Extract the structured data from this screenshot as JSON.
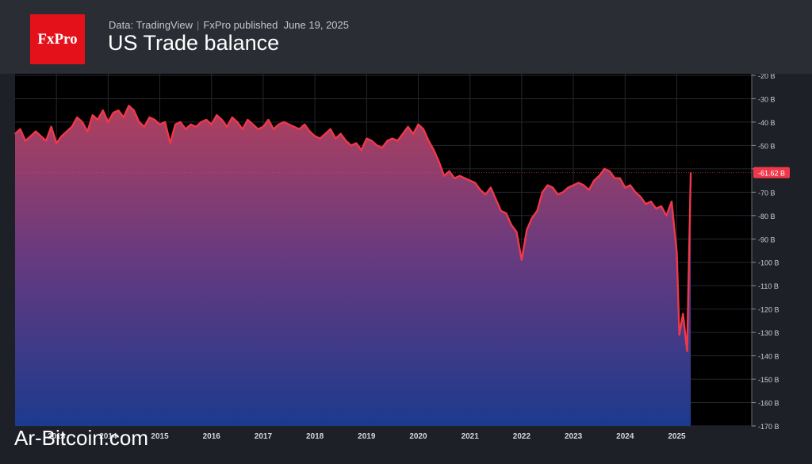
{
  "header": {
    "logo_text": "FxPro",
    "source": "Data: TradingView",
    "publisher": "FxPro published",
    "date": "June 19, 2025",
    "title": "US Trade balance"
  },
  "watermark": "Ar-Bitcoin.com",
  "chart_data": {
    "type": "area",
    "title": "US Trade balance",
    "xlabel": "",
    "ylabel": "",
    "grid": true,
    "unit": "B",
    "ylim": [
      -170,
      -20
    ],
    "xlim": [
      2012.2,
      2026.45
    ],
    "y_ticks": [
      "-20 B",
      "-30 B",
      "-40 B",
      "-50 B",
      "-60 B",
      "-70 B",
      "-80 B",
      "-90 B",
      "-100 B",
      "-110 B",
      "-120 B",
      "-130 B",
      "-140 B",
      "-150 B",
      "-160 B",
      "-170 B"
    ],
    "x_ticks": [
      {
        "label": "2013",
        "value": 2013.0
      },
      {
        "label": "2014",
        "value": 2014.0
      },
      {
        "label": "2015",
        "value": 2015.0
      },
      {
        "label": "2016",
        "value": 2016.0
      },
      {
        "label": "2017",
        "value": 2017.0
      },
      {
        "label": "2018",
        "value": 2018.0
      },
      {
        "label": "2019",
        "value": 2019.0
      },
      {
        "label": "2020",
        "value": 2020.0
      },
      {
        "label": "2021",
        "value": 2021.0
      },
      {
        "label": "2022",
        "value": 2022.0
      },
      {
        "label": "2023",
        "value": 2023.0
      },
      {
        "label": "2024",
        "value": 2024.0
      },
      {
        "label": "2025",
        "value": 2025.0
      }
    ],
    "last_value": -61.62,
    "last_label": "-61.62 B",
    "series": [
      {
        "points": [
          [
            2012.2,
            -45
          ],
          [
            2012.3,
            -43
          ],
          [
            2012.4,
            -48
          ],
          [
            2012.5,
            -46
          ],
          [
            2012.6,
            -44
          ],
          [
            2012.7,
            -46
          ],
          [
            2012.8,
            -48
          ],
          [
            2012.9,
            -42
          ],
          [
            2013.0,
            -49
          ],
          [
            2013.1,
            -46
          ],
          [
            2013.2,
            -44
          ],
          [
            2013.3,
            -42
          ],
          [
            2013.4,
            -38
          ],
          [
            2013.5,
            -40
          ],
          [
            2013.6,
            -44
          ],
          [
            2013.7,
            -37
          ],
          [
            2013.8,
            -39
          ],
          [
            2013.9,
            -35
          ],
          [
            2014.0,
            -40
          ],
          [
            2014.1,
            -36
          ],
          [
            2014.2,
            -35
          ],
          [
            2014.3,
            -38
          ],
          [
            2014.4,
            -33
          ],
          [
            2014.5,
            -35
          ],
          [
            2014.6,
            -40
          ],
          [
            2014.7,
            -42
          ],
          [
            2014.8,
            -38
          ],
          [
            2014.9,
            -39
          ],
          [
            2015.0,
            -41
          ],
          [
            2015.1,
            -40
          ],
          [
            2015.2,
            -49
          ],
          [
            2015.3,
            -41
          ],
          [
            2015.4,
            -40
          ],
          [
            2015.5,
            -43
          ],
          [
            2015.6,
            -41
          ],
          [
            2015.7,
            -42
          ],
          [
            2015.8,
            -40
          ],
          [
            2015.9,
            -39
          ],
          [
            2016.0,
            -41
          ],
          [
            2016.1,
            -37
          ],
          [
            2016.2,
            -39
          ],
          [
            2016.3,
            -42
          ],
          [
            2016.4,
            -38
          ],
          [
            2016.5,
            -40
          ],
          [
            2016.6,
            -43
          ],
          [
            2016.7,
            -39
          ],
          [
            2016.8,
            -41
          ],
          [
            2016.9,
            -43
          ],
          [
            2017.0,
            -42
          ],
          [
            2017.1,
            -39
          ],
          [
            2017.2,
            -43
          ],
          [
            2017.3,
            -41
          ],
          [
            2017.4,
            -40
          ],
          [
            2017.5,
            -41
          ],
          [
            2017.6,
            -42
          ],
          [
            2017.7,
            -43
          ],
          [
            2017.8,
            -41
          ],
          [
            2017.9,
            -44
          ],
          [
            2018.0,
            -46
          ],
          [
            2018.1,
            -47
          ],
          [
            2018.2,
            -45
          ],
          [
            2018.3,
            -43
          ],
          [
            2018.4,
            -47
          ],
          [
            2018.5,
            -45
          ],
          [
            2018.6,
            -48
          ],
          [
            2018.7,
            -50
          ],
          [
            2018.8,
            -49
          ],
          [
            2018.9,
            -52
          ],
          [
            2019.0,
            -47
          ],
          [
            2019.1,
            -48
          ],
          [
            2019.2,
            -50
          ],
          [
            2019.3,
            -51
          ],
          [
            2019.4,
            -48
          ],
          [
            2019.5,
            -47
          ],
          [
            2019.6,
            -48
          ],
          [
            2019.7,
            -45
          ],
          [
            2019.8,
            -42
          ],
          [
            2019.9,
            -45
          ],
          [
            2020.0,
            -41
          ],
          [
            2020.1,
            -43
          ],
          [
            2020.2,
            -48
          ],
          [
            2020.3,
            -52
          ],
          [
            2020.4,
            -57
          ],
          [
            2020.5,
            -63
          ],
          [
            2020.6,
            -61
          ],
          [
            2020.7,
            -64
          ],
          [
            2020.8,
            -63
          ],
          [
            2020.9,
            -64
          ],
          [
            2021.0,
            -65
          ],
          [
            2021.1,
            -66
          ],
          [
            2021.2,
            -69
          ],
          [
            2021.3,
            -71
          ],
          [
            2021.4,
            -68
          ],
          [
            2021.5,
            -73
          ],
          [
            2021.6,
            -78
          ],
          [
            2021.7,
            -79
          ],
          [
            2021.8,
            -84
          ],
          [
            2021.9,
            -87
          ],
          [
            2022.0,
            -99
          ],
          [
            2022.1,
            -86
          ],
          [
            2022.2,
            -81
          ],
          [
            2022.3,
            -78
          ],
          [
            2022.4,
            -70
          ],
          [
            2022.5,
            -67
          ],
          [
            2022.6,
            -68
          ],
          [
            2022.7,
            -71
          ],
          [
            2022.8,
            -70
          ],
          [
            2022.9,
            -68
          ],
          [
            2023.0,
            -67
          ],
          [
            2023.1,
            -66
          ],
          [
            2023.2,
            -67
          ],
          [
            2023.3,
            -69
          ],
          [
            2023.4,
            -65
          ],
          [
            2023.5,
            -63
          ],
          [
            2023.6,
            -60
          ],
          [
            2023.7,
            -61
          ],
          [
            2023.8,
            -64
          ],
          [
            2023.9,
            -64
          ],
          [
            2024.0,
            -68
          ],
          [
            2024.1,
            -67
          ],
          [
            2024.2,
            -70
          ],
          [
            2024.3,
            -72
          ],
          [
            2024.4,
            -75
          ],
          [
            2024.5,
            -74
          ],
          [
            2024.6,
            -77
          ],
          [
            2024.7,
            -76
          ],
          [
            2024.8,
            -80
          ],
          [
            2024.9,
            -74
          ],
          [
            2025.0,
            -96
          ],
          [
            2025.05,
            -131
          ],
          [
            2025.12,
            -122
          ],
          [
            2025.2,
            -138
          ],
          [
            2025.27,
            -61.62
          ]
        ]
      }
    ]
  }
}
